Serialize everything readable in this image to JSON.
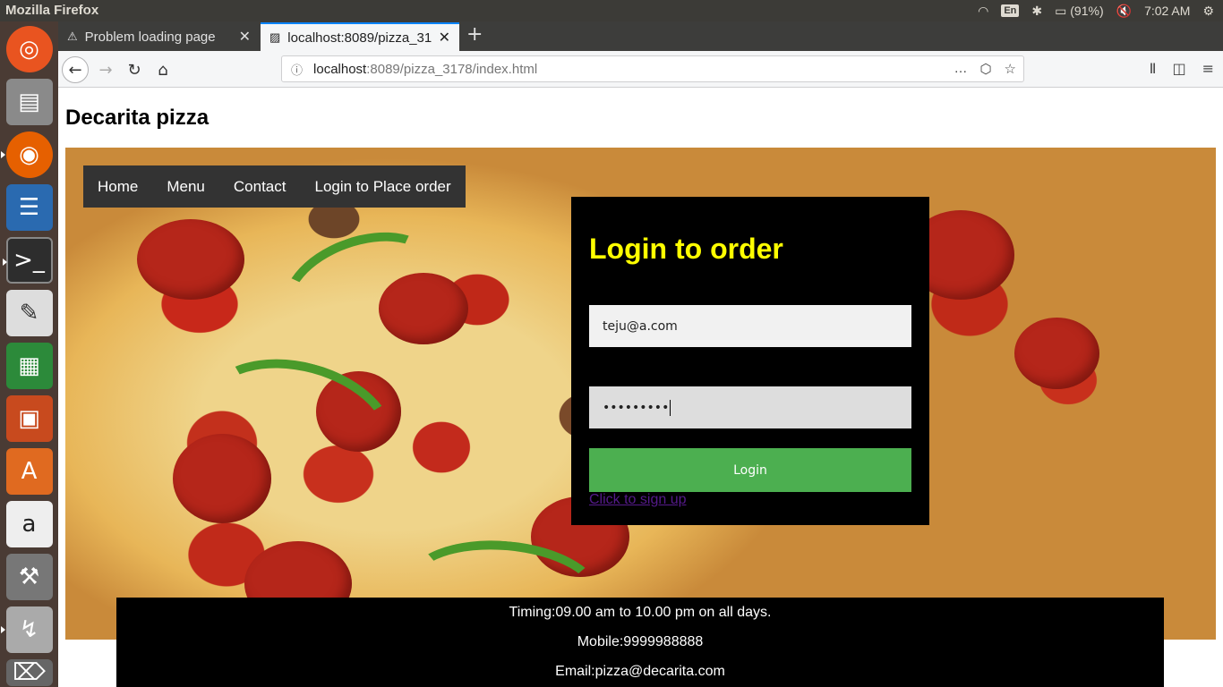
{
  "os": {
    "window_title": "Mozilla Firefox",
    "keyboard": "En",
    "battery": "(91%)",
    "time": "7:02 AM"
  },
  "browser": {
    "tabs": [
      {
        "label": "Problem loading page",
        "icon": "warning-icon",
        "active": false
      },
      {
        "label": "localhost:8089/pizza_31",
        "icon": "page-icon",
        "active": true
      }
    ],
    "url_host": "localhost",
    "url_rest": ":8089/pizza_3178/index.html"
  },
  "site": {
    "title": "Decarita pizza",
    "nav": [
      "Home",
      "Menu",
      "Contact",
      "Login to Place order"
    ]
  },
  "login": {
    "heading": "Login to order",
    "email_value": "teju@a.com",
    "password_value": "•••••••••",
    "button_label": "Login",
    "signup_link": "Click to sign up"
  },
  "footer": {
    "timing": "Timing:09.00 am to 10.00 pm on all days.",
    "mobile": "Mobile:9999988888",
    "email": "Email:pizza@decarita.com"
  },
  "colors": {
    "login_heading": "#ffff00",
    "login_button": "#4caf50",
    "nav_bg": "#333333",
    "footer_bg": "#000000"
  }
}
